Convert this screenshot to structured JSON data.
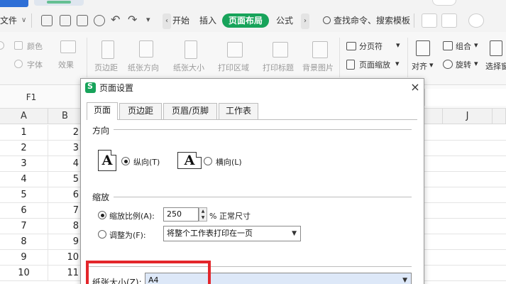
{
  "menu": {
    "file_label": "文件",
    "file_arrow": "∨",
    "undo": "↶",
    "redo": "↷",
    "more": "▾",
    "nav_left": "‹",
    "nav_right": "›",
    "tabs": [
      "开始",
      "插入",
      "页面布局",
      "公式"
    ],
    "active_tab": "页面布局",
    "search_label": "查找命令、搜索模板"
  },
  "ribbon": {
    "font_color": "颜色",
    "font": "字体",
    "effects": "效果",
    "margins": "页边距",
    "orientation": "纸张方向",
    "size": "纸张大小",
    "print_area": "打印区域",
    "print_titles": "打印标题",
    "background": "背景图片",
    "page_break": "分页符",
    "page_zoom": "页面缩放",
    "align": "对齐",
    "group": "组合",
    "rotate": "旋转",
    "selection_pane": "选择窗"
  },
  "formula_bar": {
    "cell_ref": "F1"
  },
  "grid": {
    "columns": [
      "A",
      "B",
      "J"
    ],
    "rows": [
      {
        "a": "1",
        "b": "2"
      },
      {
        "a": "2",
        "b": "3"
      },
      {
        "a": "3",
        "b": "4"
      },
      {
        "a": "4",
        "b": "5"
      },
      {
        "a": "5",
        "b": "6"
      },
      {
        "a": "6",
        "b": "7"
      },
      {
        "a": "7",
        "b": "8"
      },
      {
        "a": "8",
        "b": "9"
      },
      {
        "a": "9",
        "b": "10"
      },
      {
        "a": "10",
        "b": "11"
      }
    ]
  },
  "dialog": {
    "title": "页面设置",
    "close": "×",
    "tabs": [
      "页面",
      "页边距",
      "页眉/页脚",
      "工作表"
    ],
    "active_tab": "页面",
    "orientation": {
      "label": "方向",
      "icon_glyph": "A",
      "portrait": "纵向(T)",
      "landscape": "横向(L)",
      "selected": "portrait"
    },
    "scaling": {
      "label": "缩放",
      "adjust_label": "缩放比例(A):",
      "adjust_value": "250",
      "adjust_suffix": "% 正常尺寸",
      "fit_label": "调整为(F):",
      "fit_value": "将整个工作表打印在一页",
      "selected": "adjust"
    },
    "paper": {
      "label": "纸张大小(Z):",
      "value": "A4"
    }
  },
  "colors": {
    "accent_green": "#17a35a",
    "highlight_red": "#e3262b"
  }
}
